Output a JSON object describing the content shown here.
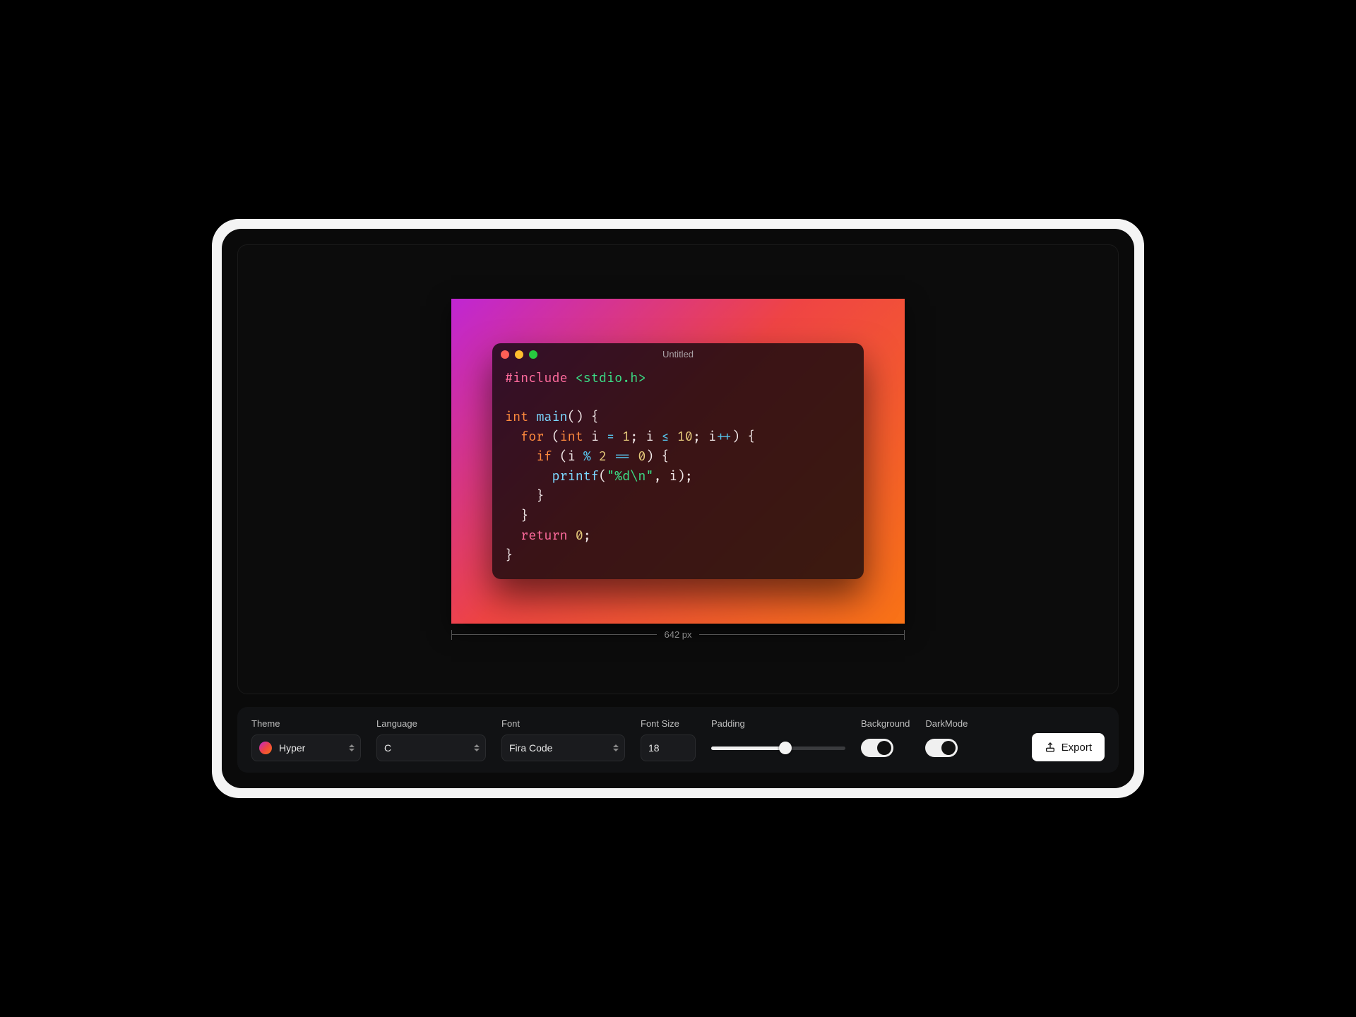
{
  "preview": {
    "window_title": "Untitled",
    "width_label": "642 px",
    "code_tokens": [
      [
        {
          "t": "#include",
          "c": "tok-pre"
        },
        {
          "t": " "
        },
        {
          "t": "<stdio.h>",
          "c": "tok-inc"
        }
      ],
      [],
      [
        {
          "t": "int",
          "c": "tok-kw"
        },
        {
          "t": " "
        },
        {
          "t": "main",
          "c": "tok-fn"
        },
        {
          "t": "() {"
        }
      ],
      [
        {
          "t": "  "
        },
        {
          "t": "for",
          "c": "tok-kw"
        },
        {
          "t": " ("
        },
        {
          "t": "int",
          "c": "tok-kw"
        },
        {
          "t": " i "
        },
        {
          "t": "=",
          "c": "tok-op"
        },
        {
          "t": " "
        },
        {
          "t": "1",
          "c": "tok-num"
        },
        {
          "t": "; i "
        },
        {
          "t": "≤",
          "c": "tok-op"
        },
        {
          "t": " "
        },
        {
          "t": "10",
          "c": "tok-num"
        },
        {
          "t": "; i"
        },
        {
          "t": "++",
          "c": "tok-op"
        },
        {
          "t": ") {"
        }
      ],
      [
        {
          "t": "    "
        },
        {
          "t": "if",
          "c": "tok-kw"
        },
        {
          "t": " (i "
        },
        {
          "t": "%",
          "c": "tok-op"
        },
        {
          "t": " "
        },
        {
          "t": "2",
          "c": "tok-num"
        },
        {
          "t": " "
        },
        {
          "t": "==",
          "c": "tok-op"
        },
        {
          "t": " "
        },
        {
          "t": "0",
          "c": "tok-num"
        },
        {
          "t": ") {"
        }
      ],
      [
        {
          "t": "      "
        },
        {
          "t": "printf",
          "c": "tok-fn"
        },
        {
          "t": "("
        },
        {
          "t": "\"%d\\n\"",
          "c": "tok-str"
        },
        {
          "t": ", i);"
        }
      ],
      [
        {
          "t": "    }"
        }
      ],
      [
        {
          "t": "  }"
        }
      ],
      [
        {
          "t": "  "
        },
        {
          "t": "return",
          "c": "tok-pre"
        },
        {
          "t": " "
        },
        {
          "t": "0",
          "c": "tok-num"
        },
        {
          "t": ";"
        }
      ],
      [
        {
          "t": "}"
        }
      ]
    ]
  },
  "controls": {
    "theme": {
      "label": "Theme",
      "value": "Hyper"
    },
    "language": {
      "label": "Language",
      "value": "C"
    },
    "font": {
      "label": "Font",
      "value": "Fira Code"
    },
    "font_size": {
      "label": "Font Size",
      "value": "18"
    },
    "padding": {
      "label": "Padding"
    },
    "background": {
      "label": "Background"
    },
    "darkmode": {
      "label": "DarkMode"
    },
    "export": {
      "label": "Export"
    }
  }
}
